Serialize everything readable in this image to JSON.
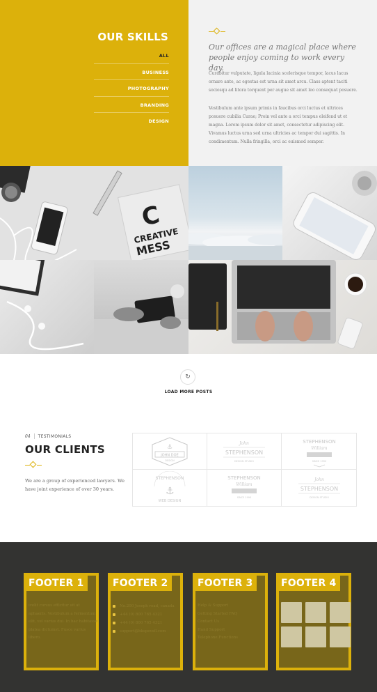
{
  "skills": {
    "title": "OUR SKILLS",
    "menu": [
      "ALL",
      "BUSINESS",
      "PHOTOGRAPHY",
      "BRANDING",
      "DESIGN"
    ]
  },
  "about": {
    "quote": "Our offices are a magical place where people enjoy coming to work every day.",
    "p1": "Curabitur vulputate, ligula lacinia scelerisque tempor, lacus lacus ornare ante, ac egestas est urna sit amet arcu. Class aptent taciti sociosqu ad litora torquent per augue sit amet leo consequat posuere.",
    "p2": "Vestibulum ante ipsum primis in faucibus orci luctus et ultrices posuere cubilia Curae; Proin vel ante a orci tempus eleifend ut et magna. Lorem ipsum dolor sit amet, consectetur adipiscing elit. Vivamus luctus urna sed urna ultricies ac tempor dui sagittis. In condimentum. Nulla fringilla, orci ac euismod semper."
  },
  "gallery": {
    "creative_c": "C",
    "creative_text1": "CREATIVE",
    "creative_text2": "MESS"
  },
  "loadmore": {
    "icon": "refresh-icon",
    "label": "LOAD MORE POSTS"
  },
  "clients": {
    "number": "04",
    "kicker": "TESTIMONIALS",
    "title": "OUR CLIENTS",
    "description": "We are a group of experienced lawyers. We have joint experience of over 30 years.",
    "logos": [
      {
        "name": "JOHN DOE",
        "sub": "DESIGN"
      },
      {
        "name": "STEPHENSON",
        "top": "John",
        "sub": "DESIGN STUDIO"
      },
      {
        "name": "STEPHENSON",
        "top": "William",
        "sub": "SINCE 1990"
      },
      {
        "name": "STEPHENSON",
        "sub": "WEB DESIGN"
      },
      {
        "name": "STEPHENSON",
        "top": "William",
        "sub": "SINCE 1990"
      },
      {
        "name": "STEPHENSON",
        "top": "John",
        "sub": "DESIGN STUDIO"
      }
    ]
  },
  "footer": {
    "col1": {
      "title": "FOOTER 1",
      "text": "ivelit cursus efficitur sit at aphaeris. Vestibulum a fermentum elit, vel varius dui. In hac habitasse platea dictumst. Fusce varius libero."
    },
    "col2": {
      "title": "FOOTER 2",
      "items": [
        "No.200 Joseph road, canada",
        "+44 (0) 800 765 4321",
        "+44 (0) 800 765 4321",
        "support@bkspevsfl.com"
      ]
    },
    "col3": {
      "title": "FOOTER 3",
      "items": [
        "Help & Support",
        "Getting Started FAQ",
        "Contact Us",
        "Hand Support",
        "Telephone Functions"
      ]
    },
    "col4": {
      "title": "FOOTER 4"
    }
  },
  "colors": {
    "accent": "#dcb10b",
    "footer_bg": "#333331"
  }
}
